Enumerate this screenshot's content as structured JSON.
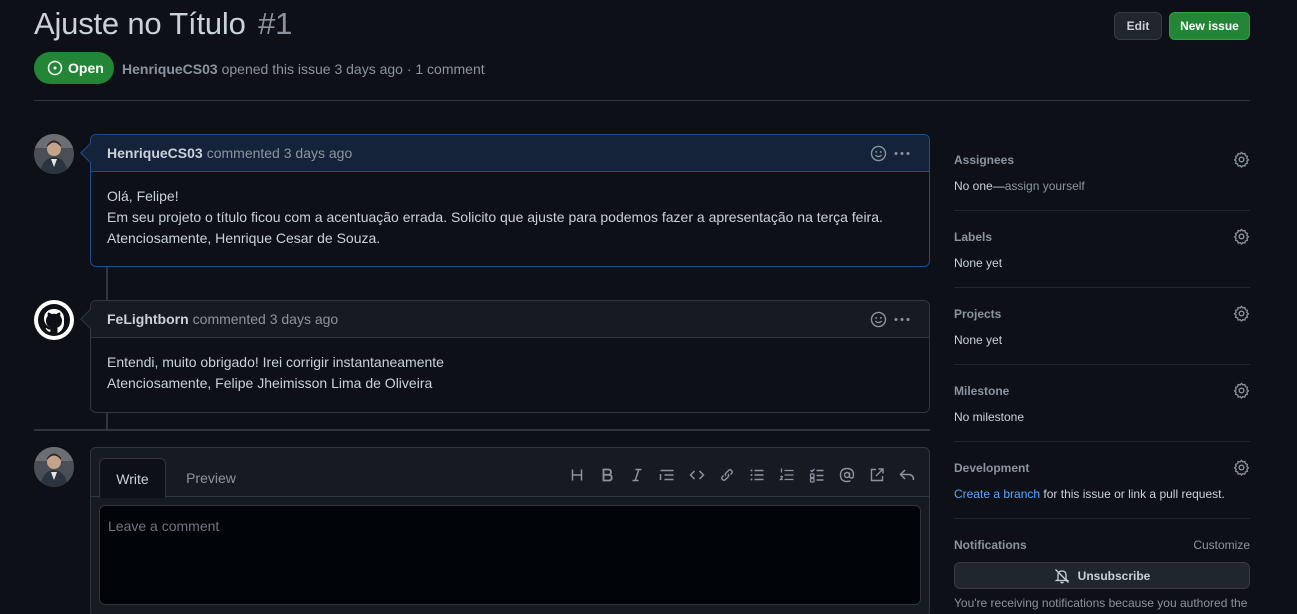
{
  "issue": {
    "title": "Ajuste no Título",
    "number": "#1",
    "state": "Open",
    "author": "HenriqueCS03",
    "meta_rest": "opened this issue 3 days ago · 1 comment"
  },
  "header_buttons": {
    "edit": "Edit",
    "new_issue": "New issue"
  },
  "comments": [
    {
      "author": "HenriqueCS03",
      "action": "commented 3 days ago",
      "lines": [
        "Olá, Felipe!",
        "Em seu projeto o título ficou com a acentuação errada. Solicito que ajuste para podemos fazer a apresentação na terça feira.",
        "Atenciosamente, Henrique Cesar de Souza."
      ]
    },
    {
      "author": "FeLightborn",
      "action": "commented 3 days ago",
      "lines": [
        "Entendi, muito obrigado! Irei corrigir instantaneamente",
        "Atenciosamente, Felipe Jheimisson Lima de Oliveira"
      ]
    }
  ],
  "composer": {
    "tab_write": "Write",
    "tab_preview": "Preview",
    "placeholder": "Leave a comment",
    "toolbar_icons": [
      "heading-icon",
      "bold-icon",
      "italic-icon",
      "quote-icon",
      "code-icon",
      "link-icon",
      "unordered-list-icon",
      "ordered-list-icon",
      "task-list-icon",
      "mention-icon",
      "cross-reference-icon",
      "reply-icon"
    ]
  },
  "sidebar": {
    "assignees": {
      "title": "Assignees",
      "value": "No one—",
      "link": "assign yourself"
    },
    "labels": {
      "title": "Labels",
      "value": "None yet"
    },
    "projects": {
      "title": "Projects",
      "value": "None yet"
    },
    "milestone": {
      "title": "Milestone",
      "value": "No milestone"
    },
    "development": {
      "title": "Development",
      "link": "Create a branch",
      "value": " for this issue or link a pull request."
    },
    "notifications": {
      "title": "Notifications",
      "customize": "Customize",
      "unsubscribe": "Unsubscribe",
      "note": "You're receiving notifications because you authored the"
    }
  },
  "colors": {
    "background": "#0d1117",
    "open_green": "#238636",
    "link_blue": "#58a6ff",
    "border": "#30363d"
  }
}
